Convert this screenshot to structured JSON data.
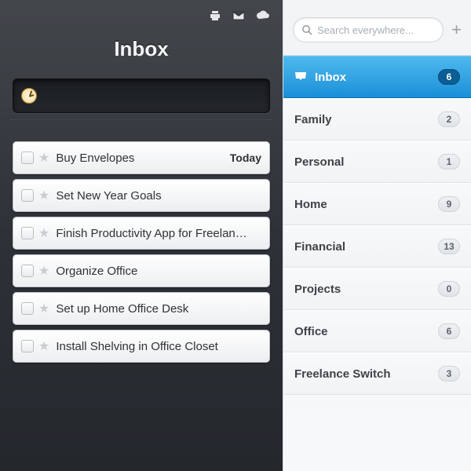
{
  "left": {
    "title": "Inbox",
    "tasks": [
      {
        "label": "Buy Envelopes",
        "due": "Today"
      },
      {
        "label": "Set New Year Goals",
        "due": ""
      },
      {
        "label": "Finish Productivity App for Freelan…",
        "due": ""
      },
      {
        "label": "Organize Office",
        "due": ""
      },
      {
        "label": "Set up Home Office Desk",
        "due": ""
      },
      {
        "label": "Install Shelving in Office Closet",
        "due": ""
      }
    ]
  },
  "right": {
    "search_placeholder": "Search everywhere...",
    "lists": [
      {
        "label": "Inbox",
        "count": "6",
        "selected": true,
        "icon": "inbox"
      },
      {
        "label": "Family",
        "count": "2",
        "selected": false
      },
      {
        "label": "Personal",
        "count": "1",
        "selected": false
      },
      {
        "label": "Home",
        "count": "9",
        "selected": false
      },
      {
        "label": "Financial",
        "count": "13",
        "selected": false
      },
      {
        "label": "Projects",
        "count": "0",
        "selected": false
      },
      {
        "label": "Office",
        "count": "6",
        "selected": false
      },
      {
        "label": "Freelance Switch",
        "count": "3",
        "selected": false
      }
    ]
  }
}
